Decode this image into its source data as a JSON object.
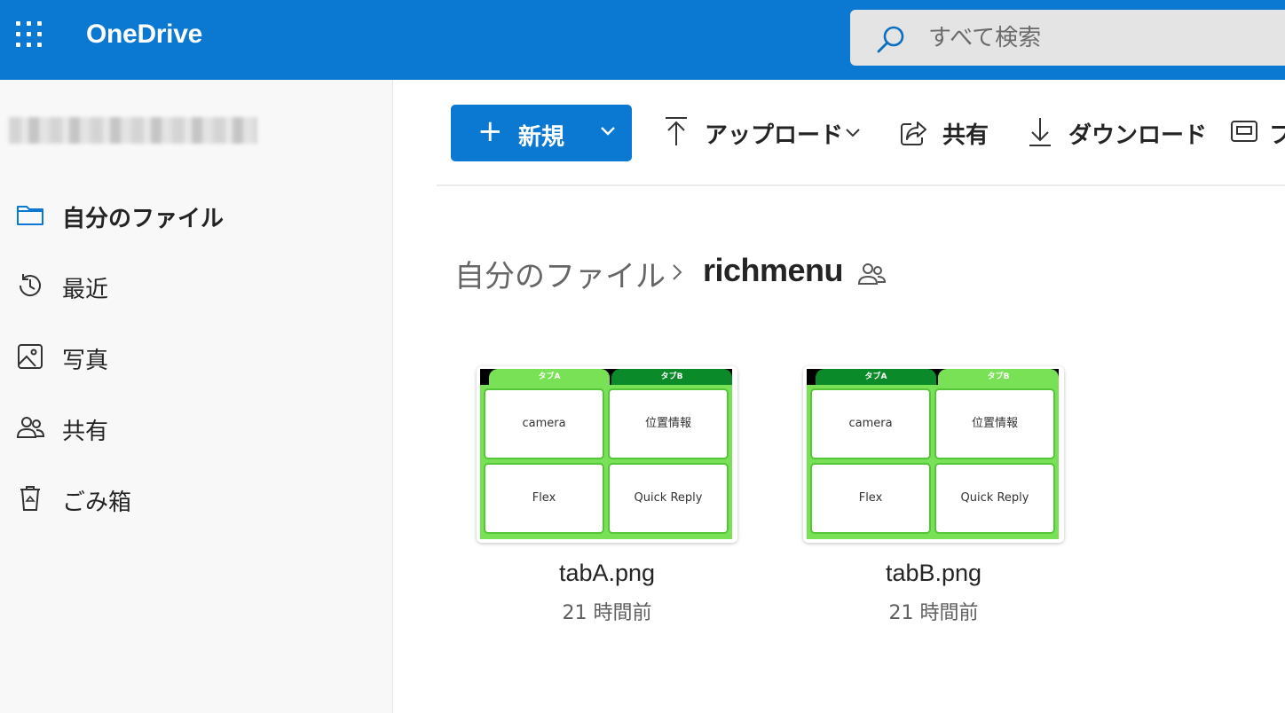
{
  "header": {
    "app_name": "OneDrive",
    "search_placeholder": "すべて検索"
  },
  "sidebar": {
    "items": [
      {
        "label": "自分のファイル",
        "icon": "folder-icon",
        "active": true
      },
      {
        "label": "最近",
        "icon": "history-icon",
        "active": false
      },
      {
        "label": "写真",
        "icon": "image-icon",
        "active": false
      },
      {
        "label": "共有",
        "icon": "people-icon",
        "active": false
      },
      {
        "label": "ごみ箱",
        "icon": "recycle-bin-icon",
        "active": false
      }
    ]
  },
  "commandbar": {
    "new_label": "新規",
    "upload_label": "アップロード",
    "share_label": "共有",
    "download_label": "ダウンロード",
    "overflow_label": "フ"
  },
  "breadcrumb": {
    "root": "自分のファイル",
    "current": "richmenu"
  },
  "files": [
    {
      "name": "tabA.png",
      "modified": "21 時間前",
      "thumb": {
        "tab_left": "タブA",
        "tab_right": "タブB",
        "active_tab": "left",
        "cells": [
          "camera",
          "位置情報",
          "Flex",
          "Quick Reply"
        ]
      }
    },
    {
      "name": "tabB.png",
      "modified": "21 時間前",
      "thumb": {
        "tab_left": "タブA",
        "tab_right": "タブB",
        "active_tab": "right",
        "cells": [
          "camera",
          "位置情報",
          "Flex",
          "Quick Reply"
        ]
      }
    }
  ],
  "colors": {
    "brand": "#0b78d1",
    "thumb_green": "#79e155",
    "thumb_dark_green": "#0b8a2a"
  }
}
